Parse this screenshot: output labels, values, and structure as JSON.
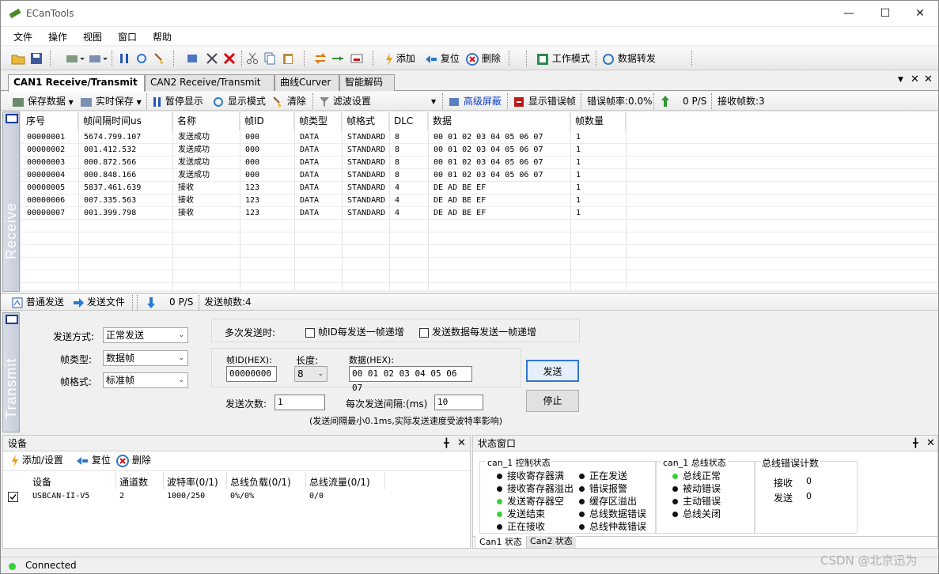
{
  "app": {
    "title": "ECanTools"
  },
  "menu": [
    "文件",
    "操作",
    "视图",
    "窗口",
    "帮助"
  ],
  "toolbar": {
    "add": "添加",
    "reset": "复位",
    "delete": "删除",
    "work_mode": "工作模式",
    "data_forward": "数据转发"
  },
  "tabs": [
    "CAN1 Receive/Transmit",
    "CAN2 Receive/Transmit",
    "曲线Curver",
    "智能解码"
  ],
  "recv_toolbar": {
    "save_data": "保存数据",
    "realtime_save": "实时保存",
    "pause": "暂停显示",
    "display_mode": "显示模式",
    "clear": "清除",
    "filter": "滤波设置",
    "adv_mask": "高级屏蔽",
    "show_errors": "显示错误帧",
    "error_rate": "错误帧率:0.0%",
    "rate": "0 P/S",
    "recv_count": "接收帧数:3"
  },
  "receive_label": "Receive",
  "transmit_label": "Transmit",
  "table": {
    "columns": [
      "序号",
      "帧间隔时间us",
      "名称",
      "帧ID",
      "帧类型",
      "帧格式",
      "DLC",
      "数据",
      "帧数量"
    ],
    "rows": [
      [
        "00000001",
        "5674.799.107",
        "发送成功",
        "000",
        "DATA",
        "STANDARD",
        "8",
        "00 01 02 03 04 05 06 07",
        "1"
      ],
      [
        "00000002",
        "001.412.532",
        "发送成功",
        "000",
        "DATA",
        "STANDARD",
        "8",
        "00 01 02 03 04 05 06 07",
        "1"
      ],
      [
        "00000003",
        "000.872.566",
        "发送成功",
        "000",
        "DATA",
        "STANDARD",
        "8",
        "00 01 02 03 04 05 06 07",
        "1"
      ],
      [
        "00000004",
        "000.848.166",
        "发送成功",
        "000",
        "DATA",
        "STANDARD",
        "8",
        "00 01 02 03 04 05 06 07",
        "1"
      ],
      [
        "00000005",
        "5837.461.639",
        "接收",
        "123",
        "DATA",
        "STANDARD",
        "4",
        "DE AD BE EF",
        "1"
      ],
      [
        "00000006",
        "007.335.563",
        "接收",
        "123",
        "DATA",
        "STANDARD",
        "4",
        "DE AD BE EF",
        "1"
      ],
      [
        "00000007",
        "001.399.798",
        "接收",
        "123",
        "DATA",
        "STANDARD",
        "4",
        "DE AD BE EF",
        "1"
      ]
    ]
  },
  "send_toolbar": {
    "normal_send": "普通发送",
    "send_file": "发送文件",
    "rate": "0 P/S",
    "send_count": "发送帧数:4"
  },
  "transmit": {
    "send_mode_label": "发送方式:",
    "send_mode_value": "正常发送",
    "frame_type_label": "帧类型:",
    "frame_type_value": "数据帧",
    "frame_format_label": "帧格式:",
    "frame_format_value": "标准帧",
    "multi_label": "多次发送时:",
    "id_inc_label": "帧ID每发送一帧递增",
    "data_inc_label": "发送数据每发送一帧递增",
    "id_label": "帧ID(HEX):",
    "id_value": "00000000",
    "len_label": "长度:",
    "len_value": "8",
    "data_label": "数据(HEX):",
    "data_value": "00 01 02 03 04 05 06 07",
    "send_btn": "发送",
    "stop_btn": "停止",
    "count_label": "发送次数:",
    "count_value": "1",
    "interval_label": "每次发送间隔:(ms)",
    "interval_value": "10",
    "note": "(发送间隔最小0.1ms,实际发送速度受波特率影响)"
  },
  "devices": {
    "title": "设备",
    "toolbar": {
      "add": "添加/设置",
      "reset": "复位",
      "delete": "删除"
    },
    "columns": [
      "设备",
      "通道数",
      "波特率(0/1)",
      "总线负载(0/1)",
      "总线流量(0/1)"
    ],
    "row": [
      "USBCAN-II-V5",
      "2",
      "1000/250",
      "0%/0%",
      "0/0"
    ]
  },
  "status_window": {
    "title": "状态窗口",
    "ctrl_title": "can_1 控制状态",
    "ctrl_left": [
      "接收寄存器满",
      "接收寄存器溢出",
      "发送寄存器空",
      "发送结束",
      "正在接收"
    ],
    "ctrl_right": [
      "正在发送",
      "错误报警",
      "缓存区溢出",
      "总线数据错误",
      "总线仲裁错误"
    ],
    "bus_title": "can_1 总线状态",
    "bus_items": [
      "总线正常",
      "被动错误",
      "主动错误",
      "总线关闭"
    ],
    "err_title": "总线错误计数",
    "err_recv_label": "接收",
    "err_recv_value": "0",
    "err_send_label": "发送",
    "err_send_value": "0",
    "tabs": [
      "Can1 状态",
      "Can2 状态"
    ]
  },
  "statusbar": {
    "text": "Connected"
  },
  "watermark": "CSDN @北京迅为",
  "colors": {
    "green": "#3ad03a",
    "blue_link": "#0a3cc8"
  }
}
